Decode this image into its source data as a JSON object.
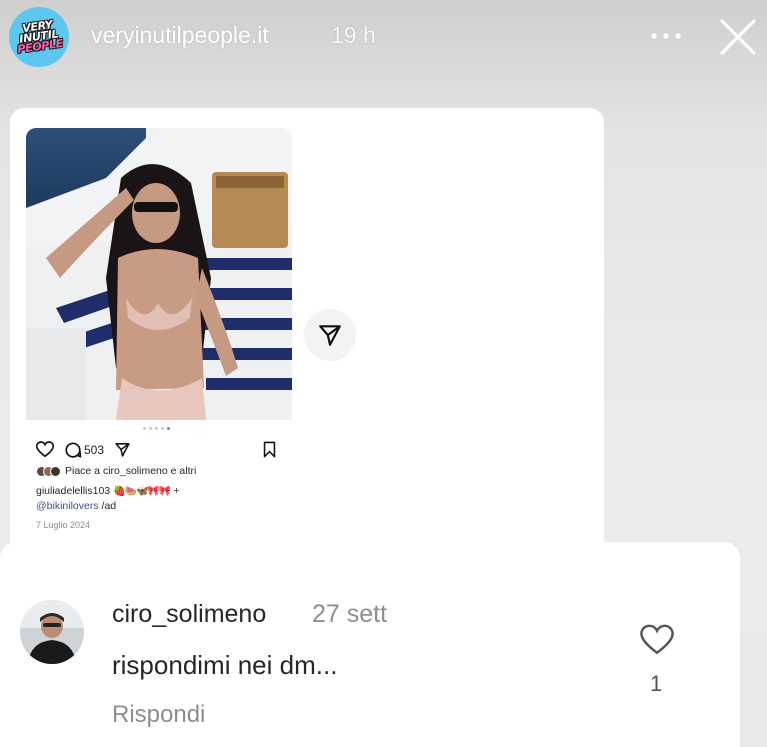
{
  "story": {
    "logo_lines": [
      "VERY",
      "INUTIL",
      "PEOPLE"
    ],
    "account": "veryinutilpeople.it",
    "time": "19 h",
    "icons": {
      "more": "more-options-icon",
      "close": "close-icon"
    }
  },
  "shared_post": {
    "comment_count": "503",
    "liked_by": "Piace a ciro_solimeno e altri",
    "caption_user": "giuliadelellis103",
    "caption_emojis": "🍓🍉🦋🎀🎀",
    "caption_plus": "+",
    "caption_mention": "@bikinilovers",
    "caption_tail": "/ad",
    "date": "7 Luglio 2024",
    "icons": {
      "like": "heart-outline-icon",
      "comment": "comment-icon",
      "share": "paper-plane-icon",
      "save": "bookmark-icon",
      "share_button": "paper-plane-icon"
    }
  },
  "comment": {
    "username": "ciro_solimeno",
    "time": "27 sett",
    "text": "rispondimi nei dm...",
    "reply_label": "Rispondi",
    "like_count": "1",
    "icons": {
      "like": "heart-outline-icon"
    }
  },
  "colors": {
    "logo_bg": "#5ec7ef",
    "logo_accent": "#ff5fae",
    "link_blue": "#385185",
    "muted": "#8e8e8e"
  }
}
